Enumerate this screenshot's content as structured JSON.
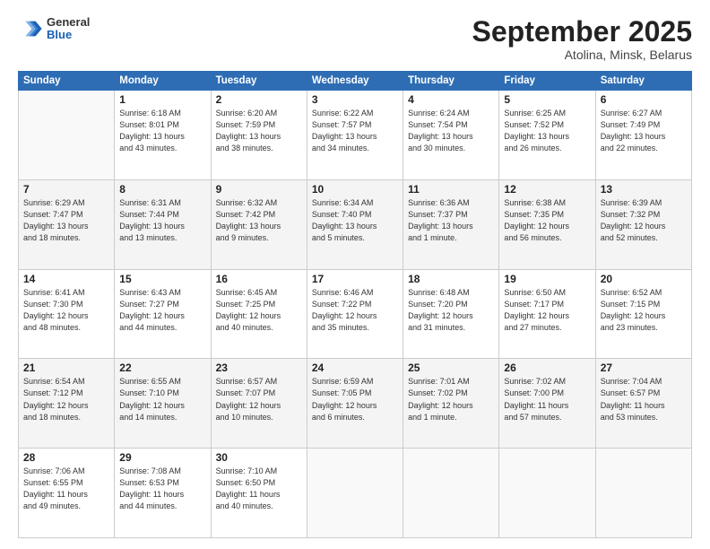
{
  "header": {
    "logo_general": "General",
    "logo_blue": "Blue",
    "month": "September 2025",
    "location": "Atolina, Minsk, Belarus"
  },
  "weekdays": [
    "Sunday",
    "Monday",
    "Tuesday",
    "Wednesday",
    "Thursday",
    "Friday",
    "Saturday"
  ],
  "weeks": [
    [
      {
        "day": "",
        "text": ""
      },
      {
        "day": "1",
        "text": "Sunrise: 6:18 AM\nSunset: 8:01 PM\nDaylight: 13 hours\nand 43 minutes."
      },
      {
        "day": "2",
        "text": "Sunrise: 6:20 AM\nSunset: 7:59 PM\nDaylight: 13 hours\nand 38 minutes."
      },
      {
        "day": "3",
        "text": "Sunrise: 6:22 AM\nSunset: 7:57 PM\nDaylight: 13 hours\nand 34 minutes."
      },
      {
        "day": "4",
        "text": "Sunrise: 6:24 AM\nSunset: 7:54 PM\nDaylight: 13 hours\nand 30 minutes."
      },
      {
        "day": "5",
        "text": "Sunrise: 6:25 AM\nSunset: 7:52 PM\nDaylight: 13 hours\nand 26 minutes."
      },
      {
        "day": "6",
        "text": "Sunrise: 6:27 AM\nSunset: 7:49 PM\nDaylight: 13 hours\nand 22 minutes."
      }
    ],
    [
      {
        "day": "7",
        "text": "Sunrise: 6:29 AM\nSunset: 7:47 PM\nDaylight: 13 hours\nand 18 minutes."
      },
      {
        "day": "8",
        "text": "Sunrise: 6:31 AM\nSunset: 7:44 PM\nDaylight: 13 hours\nand 13 minutes."
      },
      {
        "day": "9",
        "text": "Sunrise: 6:32 AM\nSunset: 7:42 PM\nDaylight: 13 hours\nand 9 minutes."
      },
      {
        "day": "10",
        "text": "Sunrise: 6:34 AM\nSunset: 7:40 PM\nDaylight: 13 hours\nand 5 minutes."
      },
      {
        "day": "11",
        "text": "Sunrise: 6:36 AM\nSunset: 7:37 PM\nDaylight: 13 hours\nand 1 minute."
      },
      {
        "day": "12",
        "text": "Sunrise: 6:38 AM\nSunset: 7:35 PM\nDaylight: 12 hours\nand 56 minutes."
      },
      {
        "day": "13",
        "text": "Sunrise: 6:39 AM\nSunset: 7:32 PM\nDaylight: 12 hours\nand 52 minutes."
      }
    ],
    [
      {
        "day": "14",
        "text": "Sunrise: 6:41 AM\nSunset: 7:30 PM\nDaylight: 12 hours\nand 48 minutes."
      },
      {
        "day": "15",
        "text": "Sunrise: 6:43 AM\nSunset: 7:27 PM\nDaylight: 12 hours\nand 44 minutes."
      },
      {
        "day": "16",
        "text": "Sunrise: 6:45 AM\nSunset: 7:25 PM\nDaylight: 12 hours\nand 40 minutes."
      },
      {
        "day": "17",
        "text": "Sunrise: 6:46 AM\nSunset: 7:22 PM\nDaylight: 12 hours\nand 35 minutes."
      },
      {
        "day": "18",
        "text": "Sunrise: 6:48 AM\nSunset: 7:20 PM\nDaylight: 12 hours\nand 31 minutes."
      },
      {
        "day": "19",
        "text": "Sunrise: 6:50 AM\nSunset: 7:17 PM\nDaylight: 12 hours\nand 27 minutes."
      },
      {
        "day": "20",
        "text": "Sunrise: 6:52 AM\nSunset: 7:15 PM\nDaylight: 12 hours\nand 23 minutes."
      }
    ],
    [
      {
        "day": "21",
        "text": "Sunrise: 6:54 AM\nSunset: 7:12 PM\nDaylight: 12 hours\nand 18 minutes."
      },
      {
        "day": "22",
        "text": "Sunrise: 6:55 AM\nSunset: 7:10 PM\nDaylight: 12 hours\nand 14 minutes."
      },
      {
        "day": "23",
        "text": "Sunrise: 6:57 AM\nSunset: 7:07 PM\nDaylight: 12 hours\nand 10 minutes."
      },
      {
        "day": "24",
        "text": "Sunrise: 6:59 AM\nSunset: 7:05 PM\nDaylight: 12 hours\nand 6 minutes."
      },
      {
        "day": "25",
        "text": "Sunrise: 7:01 AM\nSunset: 7:02 PM\nDaylight: 12 hours\nand 1 minute."
      },
      {
        "day": "26",
        "text": "Sunrise: 7:02 AM\nSunset: 7:00 PM\nDaylight: 11 hours\nand 57 minutes."
      },
      {
        "day": "27",
        "text": "Sunrise: 7:04 AM\nSunset: 6:57 PM\nDaylight: 11 hours\nand 53 minutes."
      }
    ],
    [
      {
        "day": "28",
        "text": "Sunrise: 7:06 AM\nSunset: 6:55 PM\nDaylight: 11 hours\nand 49 minutes."
      },
      {
        "day": "29",
        "text": "Sunrise: 7:08 AM\nSunset: 6:53 PM\nDaylight: 11 hours\nand 44 minutes."
      },
      {
        "day": "30",
        "text": "Sunrise: 7:10 AM\nSunset: 6:50 PM\nDaylight: 11 hours\nand 40 minutes."
      },
      {
        "day": "",
        "text": ""
      },
      {
        "day": "",
        "text": ""
      },
      {
        "day": "",
        "text": ""
      },
      {
        "day": "",
        "text": ""
      }
    ]
  ]
}
